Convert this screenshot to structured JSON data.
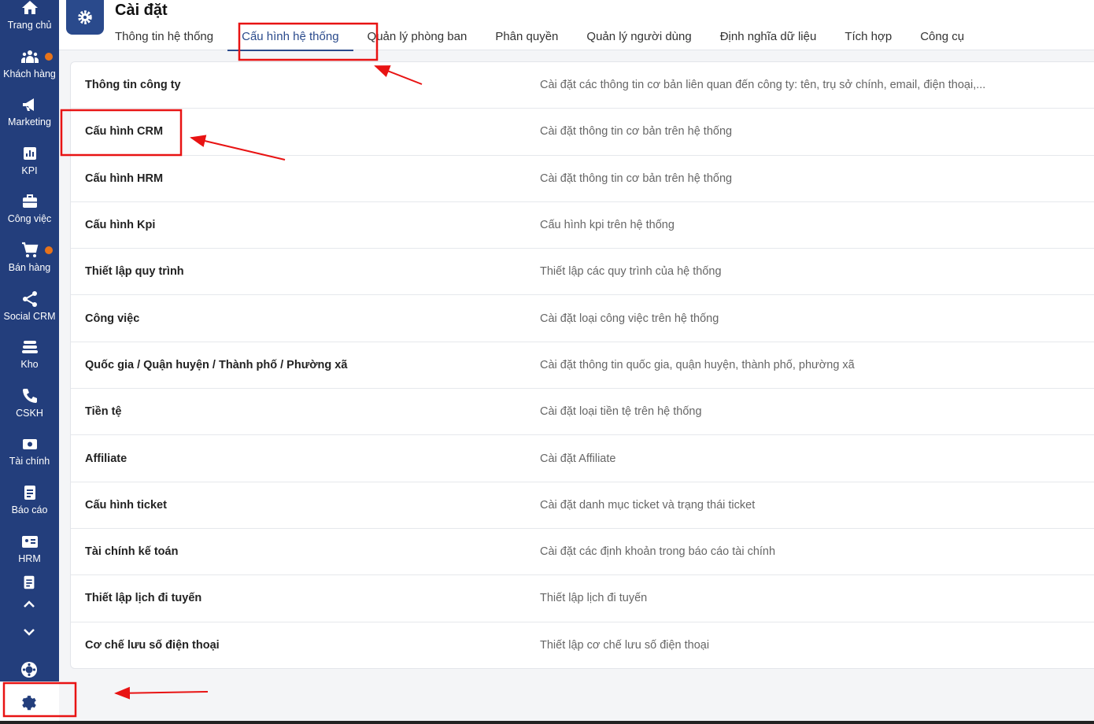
{
  "sidebar": {
    "items": [
      {
        "label": "Trang chủ",
        "icon": "home-icon"
      },
      {
        "label": "Khách hàng",
        "icon": "users-icon",
        "badge": true
      },
      {
        "label": "Marketing",
        "icon": "megaphone-icon"
      },
      {
        "label": "KPI",
        "icon": "chart-icon"
      },
      {
        "label": "Công việc",
        "icon": "briefcase-icon"
      },
      {
        "label": "Bán hàng",
        "icon": "cart-icon",
        "badge": true
      },
      {
        "label": "Social CRM",
        "icon": "share-icon"
      },
      {
        "label": "Kho",
        "icon": "warehouse-icon"
      },
      {
        "label": "CSKH",
        "icon": "phone-icon"
      },
      {
        "label": "Tài chính",
        "icon": "money-icon"
      },
      {
        "label": "Báo cáo",
        "icon": "report-icon"
      },
      {
        "label": "HRM",
        "icon": "id-card-icon"
      }
    ]
  },
  "header": {
    "title": "Cài đặt",
    "tabs": [
      "Thông tin hệ thống",
      "Cấu hình hệ thống",
      "Quản lý phòng ban",
      "Phân quyền",
      "Quản lý người dùng",
      "Định nghĩa dữ liệu",
      "Tích hợp",
      "Công cụ"
    ],
    "active_tab": 1
  },
  "settings": [
    {
      "name": "Thông tin công ty",
      "desc": "Cài đặt các thông tin cơ bản liên quan đến công ty: tên, trụ sở chính, email, điện thoại,..."
    },
    {
      "name": "Cấu hình CRM",
      "desc": "Cài đặt thông tin cơ bản trên hệ thống"
    },
    {
      "name": "Cấu hình HRM",
      "desc": "Cài đặt thông tin cơ bản trên hệ thống"
    },
    {
      "name": "Cấu hình Kpi",
      "desc": "Cấu hình kpi trên hệ thống"
    },
    {
      "name": "Thiết lập quy trình",
      "desc": "Thiết lập các quy trình của hệ thống"
    },
    {
      "name": "Công việc",
      "desc": "Cài đặt loại công việc trên hệ thống"
    },
    {
      "name": "Quốc gia / Quận huyện / Thành phố / Phường xã",
      "desc": "Cài đặt thông tin quốc gia, quận huyện, thành phố, phường xã"
    },
    {
      "name": "Tiền tệ",
      "desc": "Cài đặt loại tiền tệ trên hệ thống"
    },
    {
      "name": "Affiliate",
      "desc": "Cài đặt Affiliate"
    },
    {
      "name": "Cấu hình ticket",
      "desc": "Cài đặt danh mục ticket và trạng thái ticket"
    },
    {
      "name": "Tài chính kế toán",
      "desc": "Cài đặt các định khoản trong báo cáo tài chính"
    },
    {
      "name": "Thiết lập lịch đi tuyến",
      "desc": "Thiết lập lịch đi tuyến"
    },
    {
      "name": "Cơ chế lưu số điện thoại",
      "desc": "Thiết lập cơ chế lưu số điện thoại"
    }
  ],
  "colors": {
    "sidebar": "#233e7c",
    "accent": "#2a4a8c",
    "badge": "#e8731a",
    "annotation": "#e81313"
  }
}
